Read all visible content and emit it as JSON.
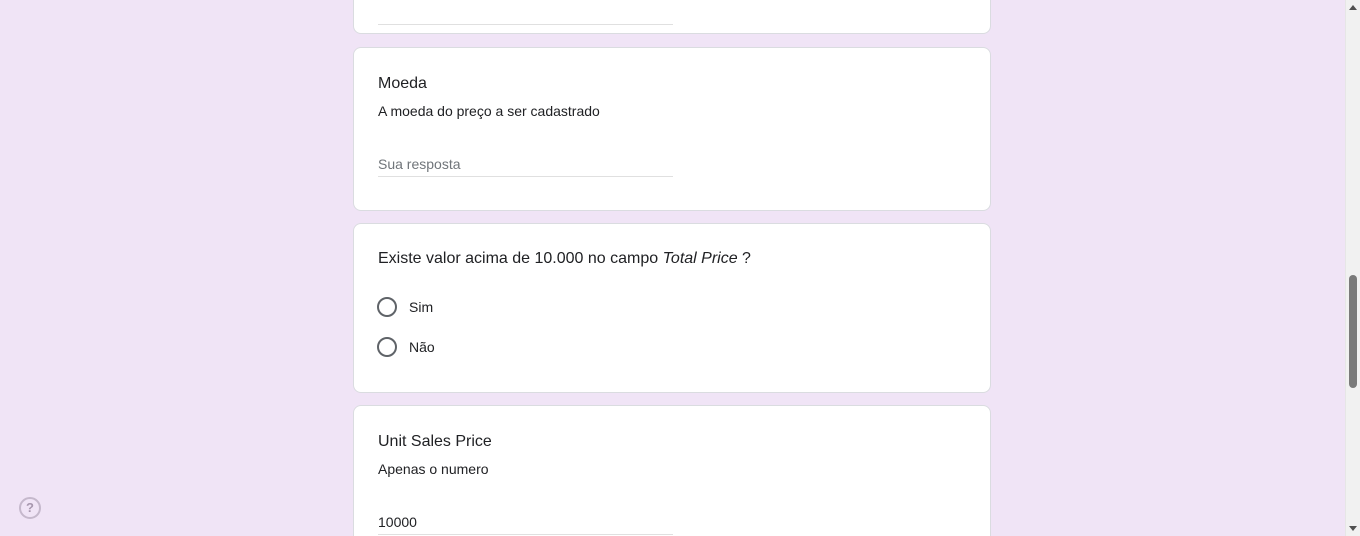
{
  "questions": {
    "moeda": {
      "title": "Moeda",
      "description": "A moeda do preço a ser cadastrado",
      "placeholder": "Sua resposta"
    },
    "existe": {
      "title_prefix": "Existe valor acima de 10.000 no campo ",
      "title_field": "Total Price",
      "title_suffix": " ?",
      "options": [
        "Sim",
        "Não"
      ]
    },
    "unit": {
      "title": "Unit Sales Price",
      "description": "Apenas o numero",
      "value": "10000"
    }
  },
  "help": {
    "glyph": "?"
  },
  "colors": {
    "background": "#f0e4f6",
    "card": "#ffffff",
    "radio_border": "#5f6368"
  }
}
